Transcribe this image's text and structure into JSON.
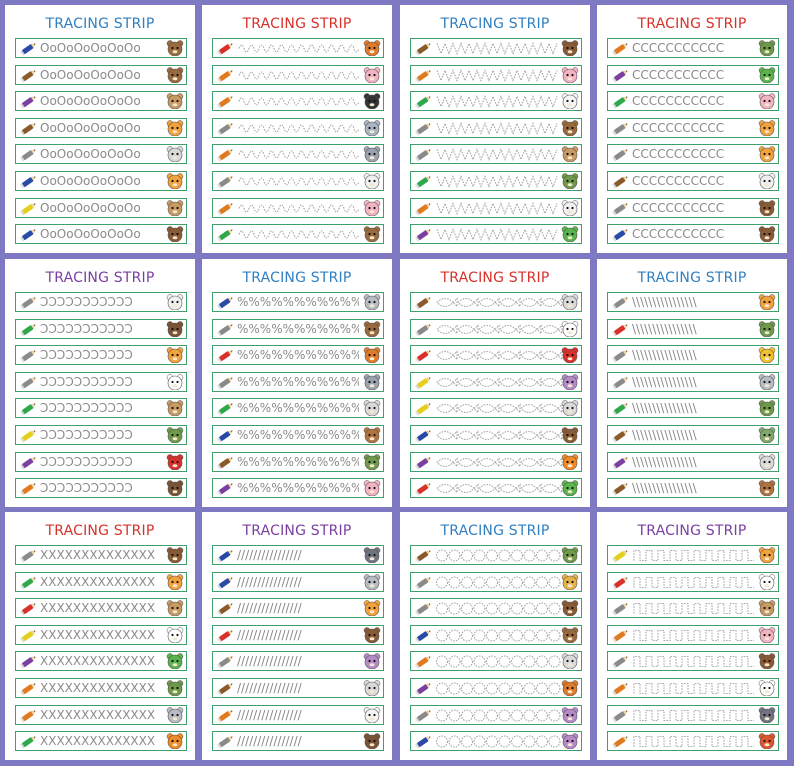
{
  "title": "TRACING STRIP",
  "colors": {
    "background": "#7f79c4",
    "strip_border": "#3fa06b",
    "title_red": "#d8312a",
    "title_blue": "#2f7fc1",
    "title_purple": "#7a3fa0"
  },
  "cards": [
    {
      "title_color": "#2f7fc1",
      "pattern": "circles-small",
      "glyphs": "OoOoOoOoOoOo",
      "pencils": [
        "#2a4aa8",
        "#8b5a2b",
        "#7a3fa0",
        "#8b5a2b",
        "#8a8a8a",
        "#2a4aa8",
        "#e5cf1c",
        "#2a4aa8"
      ],
      "animals": [
        "bear-icon",
        "bear-icon",
        "dog-icon",
        "cat-icon",
        "cow-icon",
        "cat-icon",
        "dog-icon",
        "monkey-icon"
      ]
    },
    {
      "title_color": "#d8312a",
      "pattern": "wave",
      "glyphs": "",
      "pencils": [
        "#d8312a",
        "#e07a1f",
        "#e07a1f",
        "#8a8a8a",
        "#e07a1f",
        "#8a8a8a",
        "#e07a1f",
        "#2fa84a"
      ],
      "animals": [
        "fox-icon",
        "pig-icon",
        "penguin-icon",
        "elephant-icon",
        "wolf-icon",
        "rabbit-icon",
        "pig-icon",
        "bear-icon"
      ]
    },
    {
      "title_color": "#2f7fc1",
      "pattern": "zigzag",
      "glyphs": "",
      "pencils": [
        "#8b5a2b",
        "#e07a1f",
        "#2fa84a",
        "#8a8a8a",
        "#8a8a8a",
        "#2fa84a",
        "#e07a1f",
        "#7a3fa0"
      ],
      "animals": [
        "monkey-icon",
        "pig-icon",
        "sheep-icon",
        "bear-icon",
        "dog-icon",
        "owl-icon",
        "rabbit-icon",
        "frog-icon"
      ]
    },
    {
      "title_color": "#d8312a",
      "pattern": "letter-c",
      "glyphs": "CCCCCCCCCCC",
      "pencils": [
        "#e07a1f",
        "#7a3fa0",
        "#2fa84a",
        "#8a8a8a",
        "#8a8a8a",
        "#8b5a2b",
        "#8a8a8a",
        "#2a4aa8"
      ],
      "animals": [
        "owl-icon",
        "frog-icon",
        "pig-icon",
        "cat-icon",
        "cat-icon",
        "rabbit-icon",
        "monkey-icon",
        "monkey-icon"
      ]
    },
    {
      "title_color": "#7a3fa0",
      "pattern": "reverse-c",
      "glyphs": "ↃↃↃↃↃↃↃↃↃↃↃ",
      "pencils": [
        "#8a8a8a",
        "#2fa84a",
        "#8a8a8a",
        "#8a8a8a",
        "#2fa84a",
        "#e5cf1c",
        "#7a3fa0",
        "#e07a1f"
      ],
      "animals": [
        "rabbit-icon",
        "horse-icon",
        "cat-icon",
        "panda-icon",
        "dog-icon",
        "owl-icon",
        "bird-icon",
        "horse-icon"
      ]
    },
    {
      "title_color": "#2f7fc1",
      "pattern": "percent",
      "glyphs": "%%%%%%%%%%%",
      "pencils": [
        "#2a4aa8",
        "#8a8a8a",
        "#d8312a",
        "#8a8a8a",
        "#2fa84a",
        "#2a4aa8",
        "#8b5a2b",
        "#7a3fa0"
      ],
      "animals": [
        "koala-icon",
        "bear-icon",
        "fox-icon",
        "wolf-icon",
        "cow-icon",
        "deer-icon",
        "owl-icon",
        "pig-icon"
      ]
    },
    {
      "title_color": "#d8312a",
      "pattern": "fish",
      "glyphs": "",
      "pencils": [
        "#8b5a2b",
        "#8a8a8a",
        "#d8312a",
        "#e5cf1c",
        "#e5cf1c",
        "#2a4aa8",
        "#7a3fa0",
        "#d8312a"
      ],
      "animals": [
        "cow-icon",
        "chicken-icon",
        "bird-icon",
        "hippo-icon",
        "cow-icon",
        "monkey-icon",
        "tiger-icon",
        "frog-icon"
      ]
    },
    {
      "title_color": "#2f7fc1",
      "pattern": "backslash",
      "glyphs": "\\\\\\\\\\\\\\\\\\\\\\\\\\\\\\\\",
      "pencils": [
        "#8a8a8a",
        "#d8312a",
        "#8a8a8a",
        "#8a8a8a",
        "#2fa84a",
        "#8b5a2b",
        "#7a3fa0",
        "#8b5a2b"
      ],
      "animals": [
        "cat-icon",
        "owl-icon",
        "chick-icon",
        "koala-icon",
        "owl-icon",
        "turtle-icon",
        "cow-icon",
        "deer-icon"
      ]
    },
    {
      "title_color": "#d8312a",
      "pattern": "letter-x",
      "glyphs": "XXXXXXXXXXXXXX",
      "pencils": [
        "#8a8a8a",
        "#2fa84a",
        "#d8312a",
        "#e5cf1c",
        "#7a3fa0",
        "#e07a1f",
        "#e07a1f",
        "#2fa84a"
      ],
      "animals": [
        "monkey-icon",
        "cat-icon",
        "dog-icon",
        "panda-icon",
        "frog-icon",
        "owl-icon",
        "koala-icon",
        "tiger-icon"
      ]
    },
    {
      "title_color": "#7a3fa0",
      "pattern": "slash",
      "glyphs": "////////////////",
      "pencils": [
        "#2a4aa8",
        "#2a4aa8",
        "#8b5a2b",
        "#d8312a",
        "#8a8a8a",
        "#8b5a2b",
        "#e07a1f",
        "#8a8a8a"
      ],
      "animals": [
        "raccoon-icon",
        "koala-icon",
        "cat-icon",
        "monkey-icon",
        "hippo-icon",
        "cow-icon",
        "sheep-icon",
        "horse-icon"
      ]
    },
    {
      "title_color": "#2f7fc1",
      "pattern": "loops",
      "glyphs": "",
      "pencils": [
        "#8b5a2b",
        "#8a8a8a",
        "#8a8a8a",
        "#2a4aa8",
        "#e07a1f",
        "#7a3fa0",
        "#8a8a8a",
        "#2a4aa8"
      ],
      "animals": [
        "owl-icon",
        "giraffe-icon",
        "monkey-icon",
        "bear-icon",
        "cow-icon",
        "fox-icon",
        "hippo-icon",
        "hippo-icon"
      ]
    },
    {
      "title_color": "#7a3fa0",
      "pattern": "square-wave",
      "glyphs": "",
      "pencils": [
        "#e5cf1c",
        "#d8312a",
        "#8a8a8a",
        "#e07a1f",
        "#8a8a8a",
        "#e07a1f",
        "#8a8a8a",
        "#e07a1f"
      ],
      "animals": [
        "cat-icon",
        "panda-icon",
        "dog-icon",
        "pig-icon",
        "monkey-icon",
        "panda-icon",
        "raccoon-icon",
        "crab-icon"
      ]
    }
  ]
}
